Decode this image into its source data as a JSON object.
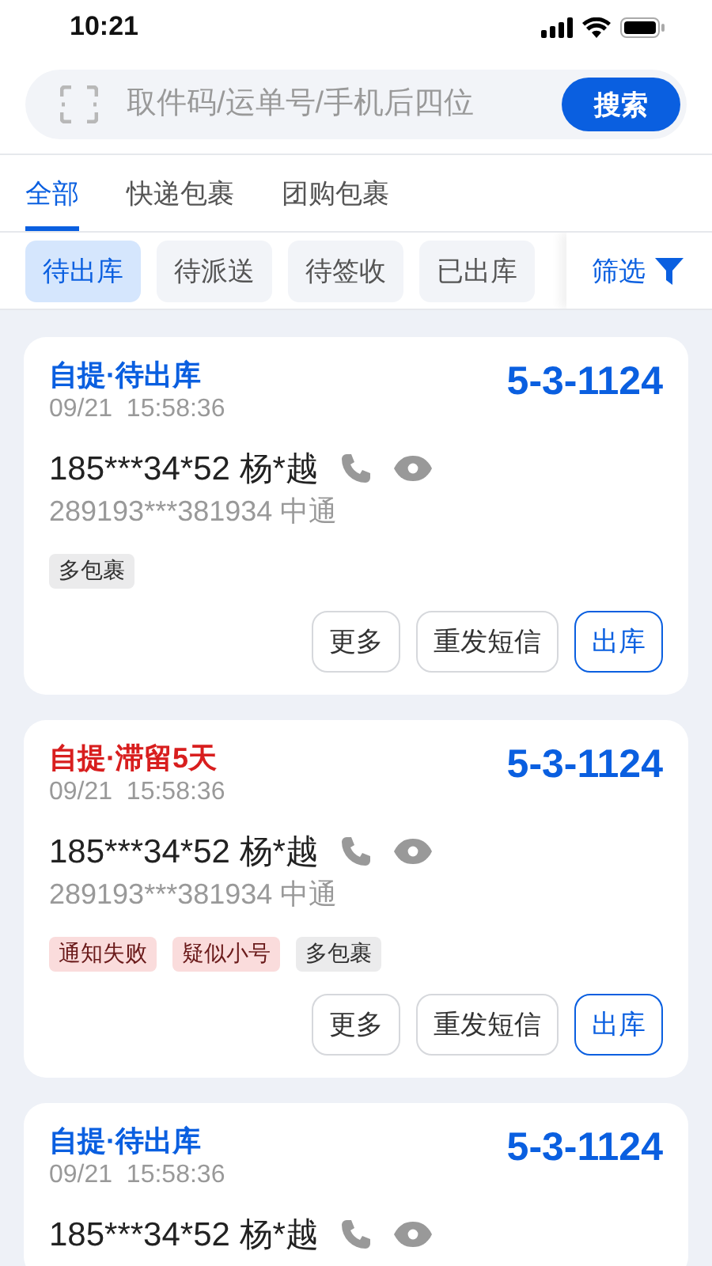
{
  "status_bar": {
    "time": "10:21"
  },
  "search": {
    "placeholder": "取件码/运单号/手机后四位",
    "button": "搜索"
  },
  "tabs": [
    {
      "label": "全部",
      "selected": true
    },
    {
      "label": "快递包裹",
      "selected": false
    },
    {
      "label": "团购包裹",
      "selected": false
    }
  ],
  "chips": [
    {
      "label": "待出库",
      "selected": true
    },
    {
      "label": "待派送",
      "selected": false
    },
    {
      "label": "待签收",
      "selected": false
    },
    {
      "label": "已出库",
      "selected": false
    }
  ],
  "filter": {
    "label": "筛选"
  },
  "cards": [
    {
      "status": "自提·待出库",
      "kind": "normal",
      "time": "09/21  15:58:36",
      "code": "5-3-1124",
      "phone": "185***34*52 杨*越",
      "waybill": "289193***381934 中通",
      "tags": [
        {
          "label": "多包裹",
          "kind": "neutral"
        }
      ],
      "actions": [
        {
          "label": "更多",
          "kind": "plain"
        },
        {
          "label": "重发短信",
          "kind": "plain"
        },
        {
          "label": "出库",
          "kind": "primary"
        }
      ]
    },
    {
      "status": "自提·滞留5天",
      "kind": "overdue",
      "time": "09/21  15:58:36",
      "code": "5-3-1124",
      "phone": "185***34*52 杨*越",
      "waybill": "289193***381934 中通",
      "tags": [
        {
          "label": "通知失败",
          "kind": "alert"
        },
        {
          "label": "疑似小号",
          "kind": "alert"
        },
        {
          "label": "多包裹",
          "kind": "neutral"
        }
      ],
      "actions": [
        {
          "label": "更多",
          "kind": "plain"
        },
        {
          "label": "重发短信",
          "kind": "plain"
        },
        {
          "label": "出库",
          "kind": "primary"
        }
      ]
    },
    {
      "status": "自提·待出库",
      "kind": "normal",
      "time": "09/21  15:58:36",
      "code": "5-3-1124",
      "phone": "185***34*52 杨*越"
    }
  ]
}
